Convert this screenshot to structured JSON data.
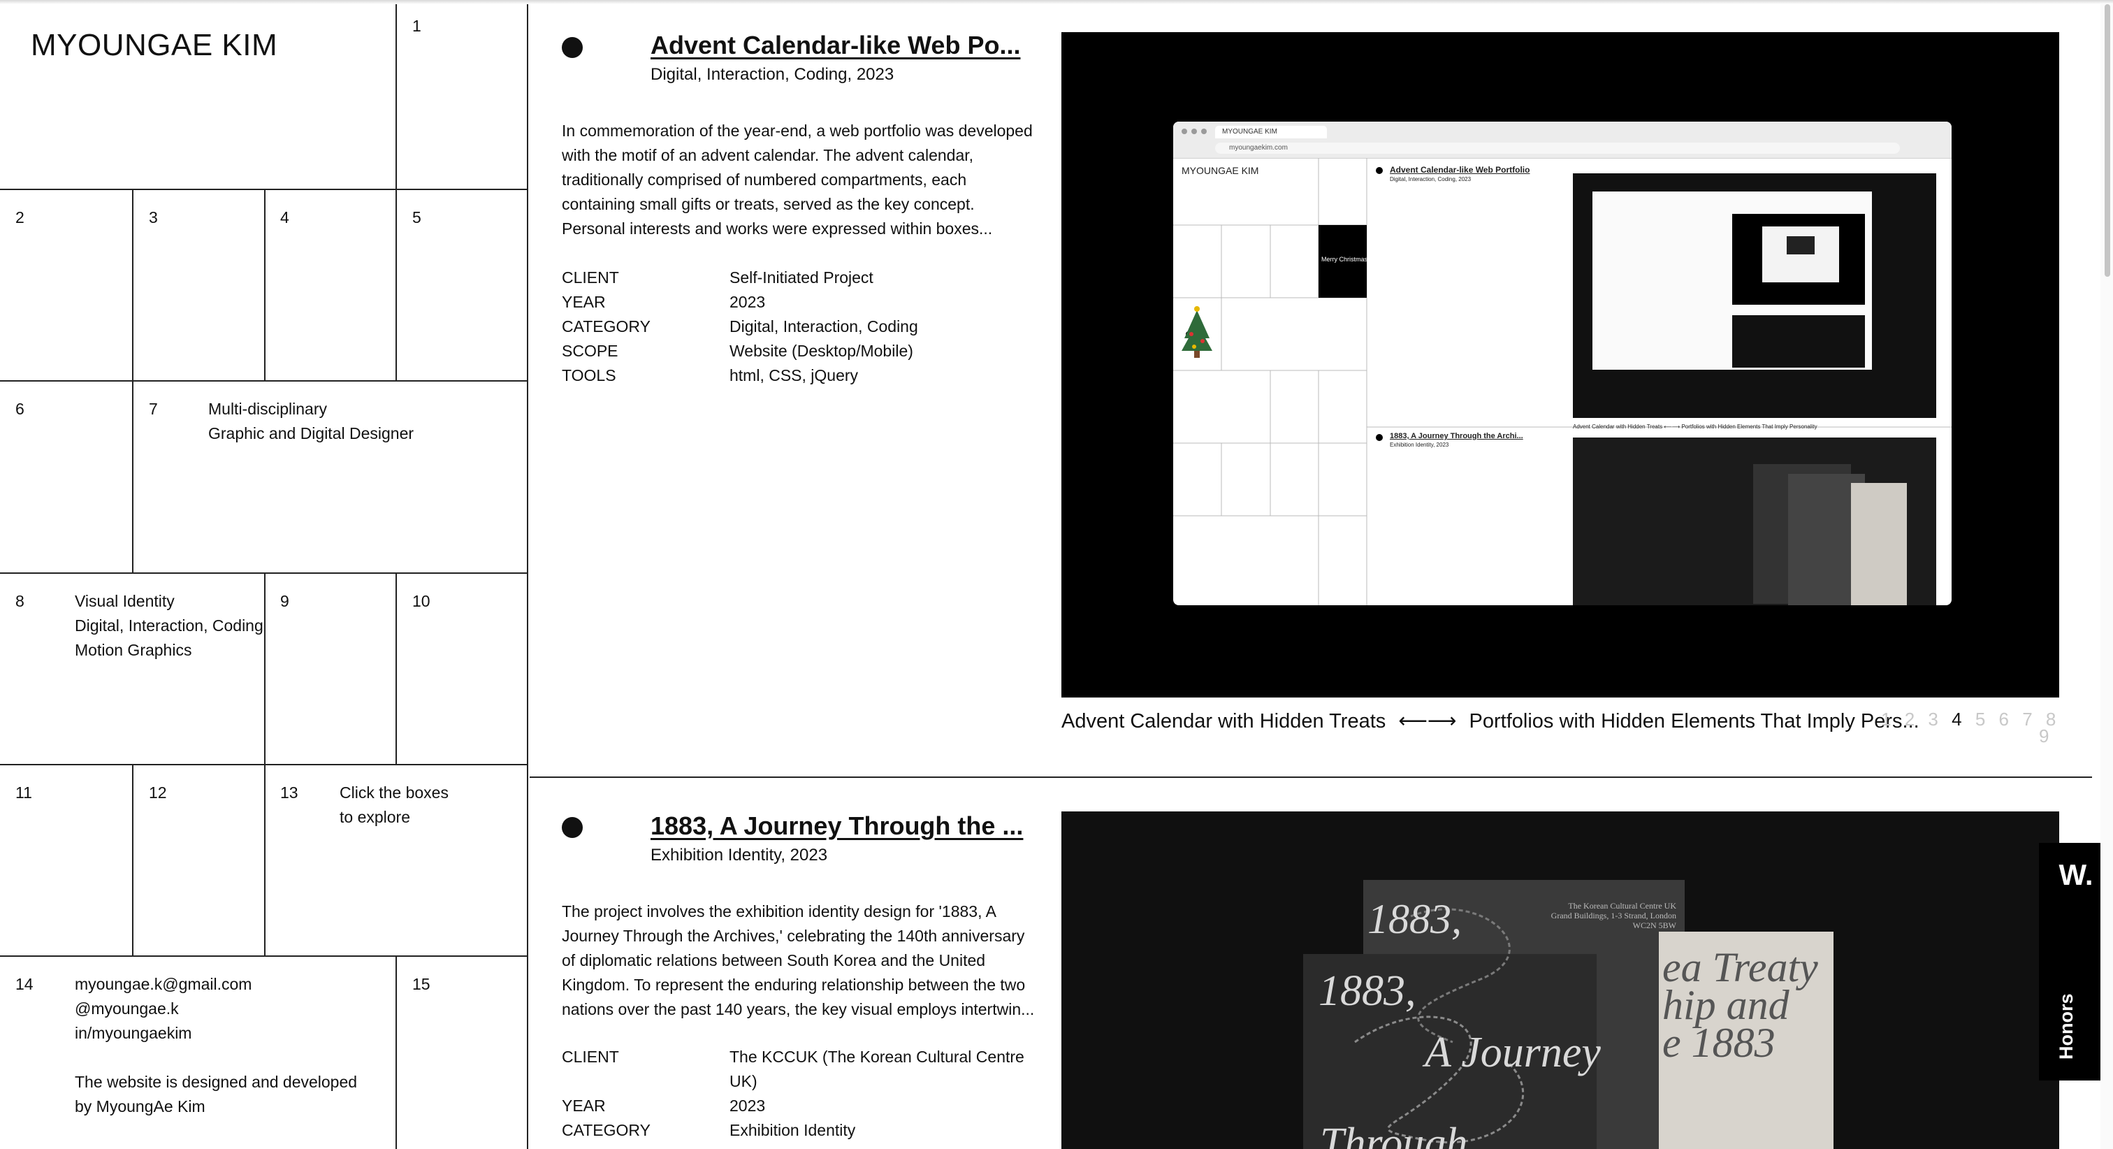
{
  "site": {
    "title": "MYOUNGAE KIM"
  },
  "grid": {
    "numbers": [
      "1",
      "2",
      "3",
      "4",
      "5",
      "6",
      "7",
      "8",
      "9",
      "10",
      "11",
      "12",
      "13",
      "14",
      "15"
    ],
    "cell7": {
      "line1": "Multi-disciplinary",
      "line2": "Graphic and Digital Designer"
    },
    "cell8": {
      "line1": "Visual Identity",
      "line2": "Digital, Interaction, Coding",
      "line3": "Motion Graphics"
    },
    "cell13": {
      "line1": "Click the boxes",
      "line2": "to explore"
    },
    "cell14": {
      "email": "myoungae.k@gmail.com",
      "instagram": "@myoungae.k",
      "linkedin": "in/myoungaekim",
      "credit1": "The website is designed and developed",
      "credit2": "by MyoungAe Kim"
    }
  },
  "projects": [
    {
      "title": "Advent Calendar-like Web Po...",
      "subtitle": "Digital, Interaction, Coding, 2023",
      "description": "In commemoration of the year-end, a web portfolio was developed with the motif of an advent calendar. The advent calendar, traditionally comprised of numbered compartments, each containing small gifts or treats, served as the key concept. Personal interests and works were expressed within boxes...",
      "meta": [
        {
          "key": "CLIENT",
          "value": "Self-Initiated Project"
        },
        {
          "key": "YEAR",
          "value": "2023"
        },
        {
          "key": "CATEGORY",
          "value": "Digital, Interaction, Coding"
        },
        {
          "key": "SCOPE",
          "value": "Website (Desktop/Mobile)"
        },
        {
          "key": "TOOLS",
          "value": "html, CSS, jQuery"
        }
      ],
      "caption_left": "Advent Calendar with Hidden Treats",
      "caption_arrow": "⟵⟶",
      "caption_right": "Portfolios with Hidden Elements That Imply Pers...",
      "pages": [
        "1",
        "2",
        "3",
        "4",
        "5",
        "6",
        "7",
        "8",
        "9"
      ],
      "active_page": "4",
      "mock": {
        "tab": "MYOUNGAE KIM",
        "url": "myoungaekim.com",
        "site_title": "MYOUNGAE KIM",
        "proj1_title": "Advent Calendar-like Web Portfolio",
        "proj1_sub": "Digital, Interaction, Coding, 2023",
        "proj2_title": "1883, A Journey Through the Archi...",
        "proj2_sub": "Exhibition Identity, 2023",
        "greeting": "Merry Christmas!",
        "caption": "Advent Calendar with Hidden Treats ⟵⟶ Portfolios with Hidden Elements That Imply Personality"
      }
    },
    {
      "title": "1883, A Journey Through the ...",
      "subtitle": "Exhibition Identity, 2023",
      "description": "The project involves the exhibition identity design for '1883, A Journey Through the Archives,' celebrating the 140th anniversary of diplomatic relations between South Korea and the United Kingdom. To represent the enduring relationship between the two nations over the past 140 years, the key visual employs intertwin...",
      "meta": [
        {
          "key": "CLIENT",
          "value": "The KCCUK (The Korean Cultural Centre UK)"
        },
        {
          "key": "YEAR",
          "value": "2023"
        },
        {
          "key": "CATEGORY",
          "value": "Exhibition Identity"
        }
      ],
      "poster": {
        "big1": "1883,",
        "big2": "A Journey",
        "big3": "Through",
        "venue": "The Korean Cultural Centre UK\nGrand Buildings, 1-3 Strand, London\nWC2N 5BW",
        "side_big": "ea Treaty\nhip and\ne 1883"
      }
    }
  ],
  "side_tab": {
    "logo": "W.",
    "label": "Honors"
  },
  "colors": {
    "ink": "#111111",
    "black": "#000000",
    "pager_inactive": "#c8c8c8",
    "poster_bg": "#2b2b2b"
  }
}
